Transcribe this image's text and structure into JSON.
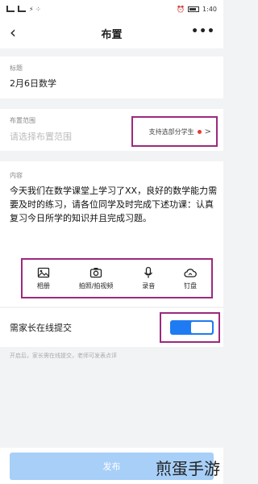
{
  "status_bar": {
    "left": "⚡ ⁘",
    "time": "1:40"
  },
  "header": {
    "title": "布置",
    "back_icon": "chevron-left-icon",
    "more_icon": "more-dots-icon"
  },
  "title_section": {
    "label": "标题",
    "value": "2月6日数学"
  },
  "scope_section": {
    "label": "布置范围",
    "placeholder": "请选择布置范围",
    "support_text": "支持选部分学生"
  },
  "content_section": {
    "label": "内容",
    "text": "今天我们在数学课堂上学习了XX，良好的数学能力需要及时的练习，请各位同学及时完成下述功课：认真复习今日所学的知识并且完成习题。"
  },
  "tools": [
    {
      "name": "album",
      "label": "相册",
      "icon": "image-icon"
    },
    {
      "name": "camera",
      "label": "拍照/拍视频",
      "icon": "camera-icon"
    },
    {
      "name": "record",
      "label": "录音",
      "icon": "microphone-icon"
    },
    {
      "name": "drive",
      "label": "钉盘",
      "icon": "cloud-icon"
    }
  ],
  "parent_submit": {
    "label": "需家长在线提交",
    "enabled": true,
    "hint": "开启后，家长需在线提交，老师可发表点评"
  },
  "publish": {
    "label": "发布"
  },
  "watermark": "煎蛋手游",
  "colors": {
    "accent": "#1f7bf2",
    "highlight_border": "#9c2a7e",
    "publish_disabled": "#a7cff8"
  }
}
